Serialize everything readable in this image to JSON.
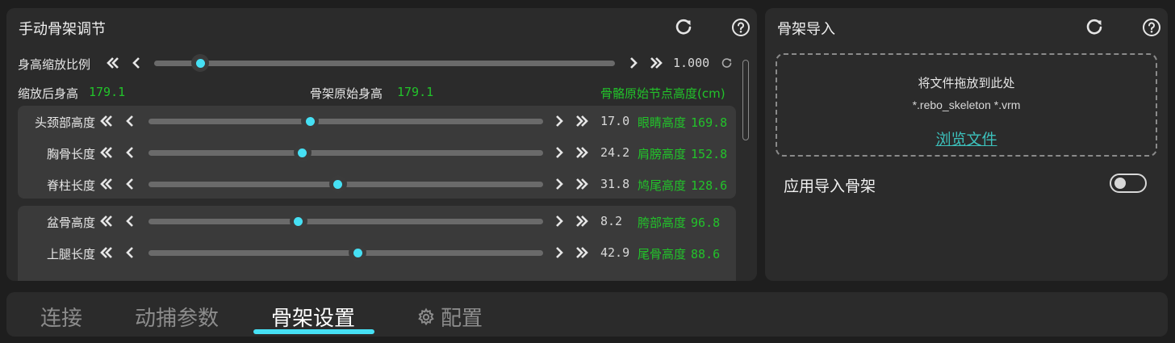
{
  "manual_panel": {
    "title": "手动骨架调节",
    "height_scale": {
      "label": "身高缩放比例",
      "value": "1.000",
      "progress": 0.1
    },
    "info": {
      "scaled_height_label": "缩放后身高",
      "scaled_height_value": "179.1",
      "original_height_label": "骨架原始身高",
      "original_height_value": "179.1",
      "node_height_header": "骨骼原始节点高度(cm)"
    },
    "group1": [
      {
        "label": "头颈部高度",
        "value": "17.0",
        "node_label": "眼睛高度",
        "node_value": "169.8",
        "progress": 0.41
      },
      {
        "label": "胸骨长度",
        "value": "24.2",
        "node_label": "肩膀高度",
        "node_value": "152.8",
        "progress": 0.39
      },
      {
        "label": "脊柱长度",
        "value": "31.8",
        "node_label": "鸠尾高度",
        "node_value": "128.6",
        "progress": 0.48
      }
    ],
    "group2": [
      {
        "label": "盆骨高度",
        "value": "8.2",
        "node_label": "胯部高度",
        "node_value": "96.8",
        "progress": 0.38
      },
      {
        "label": "上腿长度",
        "value": "42.9",
        "node_label": "尾骨高度",
        "node_value": "88.6",
        "progress": 0.53
      }
    ]
  },
  "import_panel": {
    "title": "骨架导入",
    "drop_text": "将文件拖放到此处",
    "file_types": "*.rebo_skeleton *.vrm",
    "browse_link": "浏览文件",
    "apply_label": "应用导入骨架",
    "apply_enabled": false
  },
  "tabs": [
    {
      "label": "连接",
      "active": false
    },
    {
      "label": "动捕参数",
      "active": false
    },
    {
      "label": "骨架设置",
      "active": true
    },
    {
      "label": "配置",
      "active": false,
      "icon": "gear-icon"
    }
  ],
  "colors": {
    "accent": "#46e0f4",
    "green": "#22c32a",
    "link": "#3cc0bb",
    "panel_bg": "#2b2b2b",
    "page_bg": "#1e1e1e"
  }
}
